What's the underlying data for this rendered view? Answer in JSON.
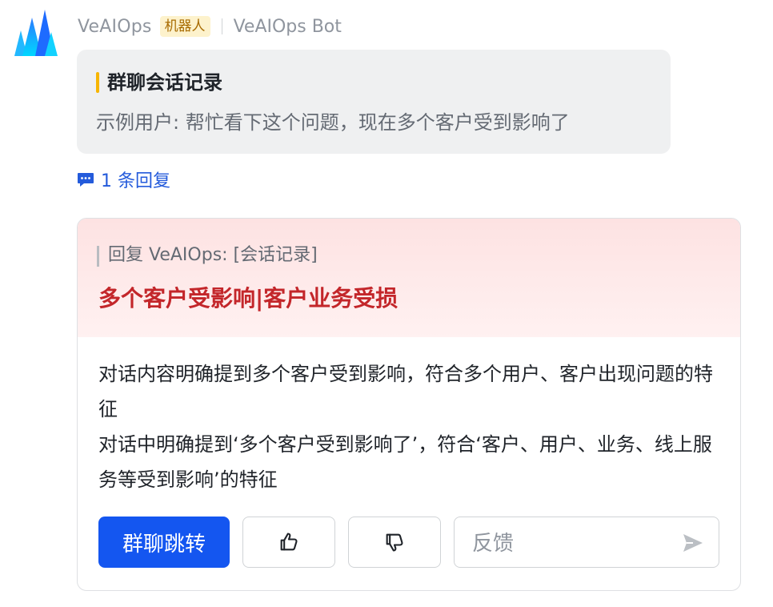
{
  "sender": {
    "name": "VeAIOps",
    "tag": "机器人",
    "bot_name": "VeAIOps Bot"
  },
  "quote_card": {
    "title": "群聊会话记录",
    "body": "示例用户: 帮忙看下这个问题，现在多个客户受到影响了"
  },
  "reply_link": {
    "label": "1 条回复"
  },
  "card": {
    "reply_quote": "回复 VeAIOps: [会话记录]",
    "title": "多个客户受影响|客户业务受损",
    "body_lines": [
      "对话内容明确提到多个客户受到影响，符合多个用户、客户出现问题的特征",
      "对话中明确提到‘多个客户受到影响了’，符合‘客户、用户、业务、线上服务等受到影响’的特征"
    ],
    "actions": {
      "jump_label": "群聊跳转",
      "feedback_placeholder": "反馈"
    }
  },
  "colors": {
    "primary": "#1456f0",
    "title_red": "#c3262a",
    "tag_bg": "#fdf2cc",
    "quote_bar": "#f7b500"
  }
}
